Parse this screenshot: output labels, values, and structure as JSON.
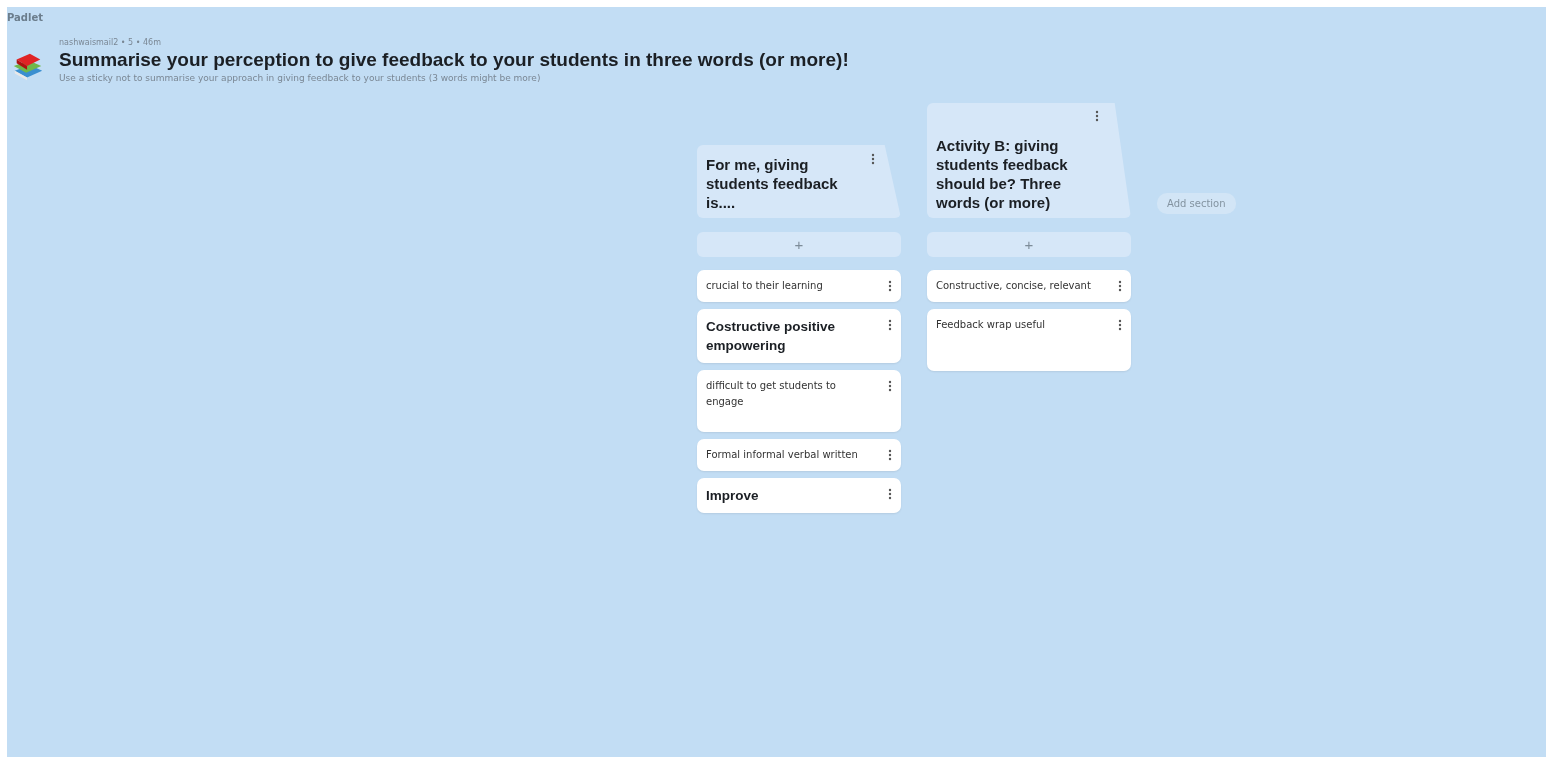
{
  "brand": "Padlet",
  "board": {
    "meta": "nashwaismail2 • 5 • 46m",
    "title": "Summarise your  perception to give feedback to your students  in three words (or more)!",
    "description": "Use a sticky not to summarise your approach in giving feedback to your students  (3 words might be more)"
  },
  "sections": [
    {
      "title": "For me, giving students feedback is....",
      "add": "+",
      "posts": [
        {
          "kind": "plain",
          "text": "crucial to their learning"
        },
        {
          "kind": "bold",
          "text": "Costructive positive empowering"
        },
        {
          "kind": "plain",
          "text": "difficult to get students to engage"
        },
        {
          "kind": "plain",
          "text": "Formal informal verbal written"
        },
        {
          "kind": "bold",
          "text": "Improve"
        }
      ]
    },
    {
      "title": "Activity B: giving students feedback should be? Three words (or more)",
      "add": "+",
      "posts": [
        {
          "kind": "plain",
          "text": "Constructive, concise, relevant"
        },
        {
          "kind": "plain",
          "text": "Feedback wrap useful"
        }
      ]
    }
  ],
  "add_section": "Add section"
}
